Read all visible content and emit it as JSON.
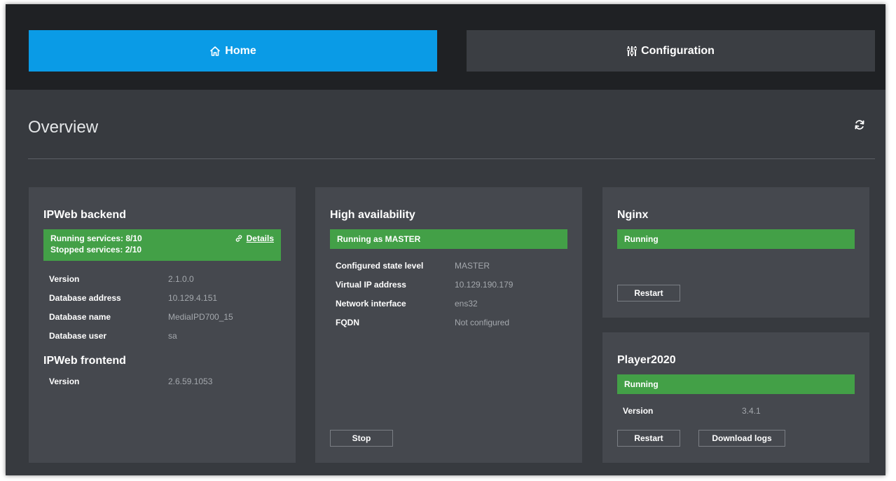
{
  "nav": {
    "home": {
      "label": "Home",
      "icon": "home-icon"
    },
    "configuration": {
      "label": "Configuration",
      "icon": "sliders-icon"
    }
  },
  "page": {
    "title": "Overview",
    "refresh_icon": "refresh-icon"
  },
  "colors": {
    "accent": "#0a9be6",
    "status_ok": "#43a047",
    "panel": "#45484e",
    "background": "#373a3f",
    "topbar": "#1f2124"
  },
  "ipweb_backend": {
    "title": "IPWeb backend",
    "status_line1": "Running services: 8/10",
    "status_line2": "Stopped services: 2/10",
    "details_label": "Details",
    "details_icon": "link-icon",
    "rows": [
      {
        "label": "Version",
        "value": "2.1.0.0"
      },
      {
        "label": "Database address",
        "value": "10.129.4.151"
      },
      {
        "label": "Database name",
        "value": "MediaIPD700_15"
      },
      {
        "label": "Database user",
        "value": "sa"
      }
    ]
  },
  "ipweb_frontend": {
    "title": "IPWeb frontend",
    "rows": [
      {
        "label": "Version",
        "value": "2.6.59.1053"
      }
    ]
  },
  "high_availability": {
    "title": "High availability",
    "status": "Running as MASTER",
    "rows": [
      {
        "label": "Configured state level",
        "value": "MASTER"
      },
      {
        "label": "Virtual IP address",
        "value": "10.129.190.179"
      },
      {
        "label": "Network interface",
        "value": "ens32"
      },
      {
        "label": "FQDN",
        "value": "Not configured"
      }
    ],
    "stop_label": "Stop"
  },
  "nginx": {
    "title": "Nginx",
    "status": "Running",
    "restart_label": "Restart"
  },
  "player2020": {
    "title": "Player2020",
    "status": "Running",
    "rows": [
      {
        "label": "Version",
        "value": "3.4.1"
      }
    ],
    "restart_label": "Restart",
    "download_logs_label": "Download logs"
  }
}
